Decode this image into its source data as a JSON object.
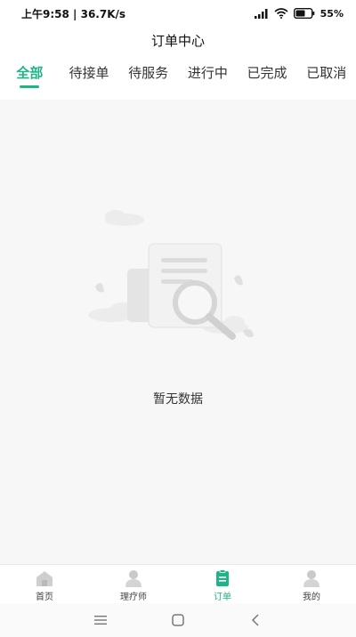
{
  "status_bar": {
    "time": "上午9:58",
    "network_speed": "36.7K/s",
    "battery": "55%",
    "icons": [
      "signal-icon",
      "wifi-icon",
      "battery-icon"
    ]
  },
  "header": {
    "title": "订单中心"
  },
  "tabs": [
    {
      "label": "全部",
      "active": true
    },
    {
      "label": "待接单",
      "active": false
    },
    {
      "label": "待服务",
      "active": false
    },
    {
      "label": "进行中",
      "active": false
    },
    {
      "label": "已完成",
      "active": false
    },
    {
      "label": "已取消",
      "active": false
    }
  ],
  "empty_state": {
    "icon": "empty-document-search-icon",
    "text": "暂无数据"
  },
  "bottom_nav": [
    {
      "label": "首页",
      "icon": "home-icon",
      "active": false
    },
    {
      "label": "理疗师",
      "icon": "therapist-icon",
      "active": false
    },
    {
      "label": "订单",
      "icon": "order-icon",
      "active": true
    },
    {
      "label": "我的",
      "icon": "profile-icon",
      "active": false
    }
  ],
  "system_nav": [
    "menu-icon",
    "home-square-icon",
    "back-icon"
  ],
  "colors": {
    "accent": "#1fb487",
    "background": "#f7f7f7",
    "surface": "#ffffff"
  }
}
